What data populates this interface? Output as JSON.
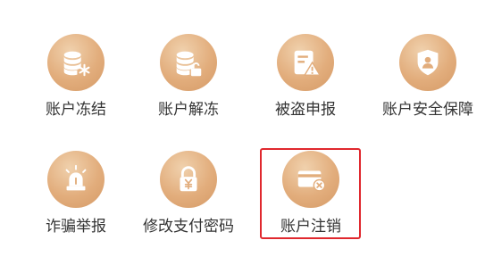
{
  "menu": {
    "items": [
      {
        "label": "账户冻结",
        "icon": "database-lock-icon"
      },
      {
        "label": "账户解冻",
        "icon": "database-unlock-icon"
      },
      {
        "label": "被盗申报",
        "icon": "report-warning-icon"
      },
      {
        "label": "账户安全保障",
        "icon": "shield-user-icon"
      },
      {
        "label": "诈骗举报",
        "icon": "alarm-siren-icon"
      },
      {
        "label": "修改支付密码",
        "icon": "padlock-yen-icon"
      },
      {
        "label": "账户注销",
        "icon": "card-cancel-icon"
      }
    ]
  },
  "colors": {
    "icon_gradient": "#e2ad7c",
    "highlight": "#e0282e",
    "label": "#333333"
  }
}
